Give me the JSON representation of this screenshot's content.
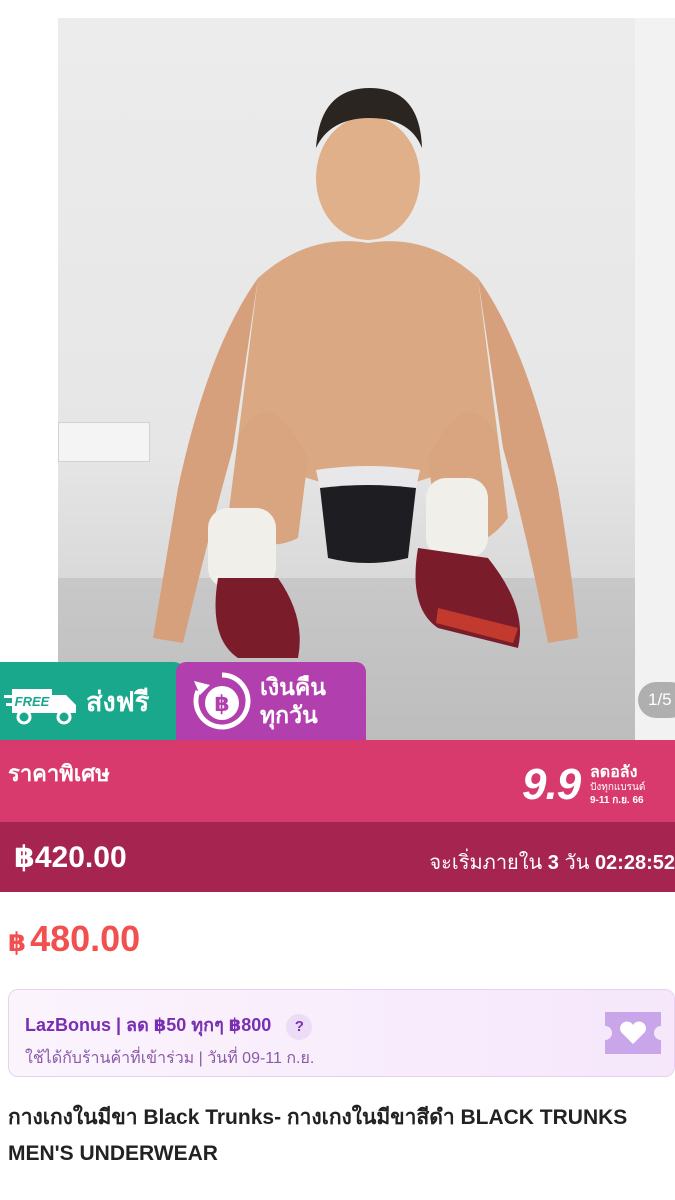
{
  "gallery": {
    "page_indicator": "1/5"
  },
  "badges": {
    "free_tag": "FREE",
    "free_shipping": "ส่งฟรี",
    "cashback_line1": "เงินคืน",
    "cashback_line2": "ทุกวัน"
  },
  "special_price": {
    "label": "ราคาพิเศษ",
    "campaign_number": "9.9",
    "campaign_main": "ลดอลัง",
    "campaign_sub": "ปังทุกแบรนด์",
    "campaign_date": "9-11 ก.ย. 66",
    "price": "฿420.00",
    "countdown_prefix": "จะเริ่มภายใน",
    "countdown_days": "3",
    "countdown_unit": "วัน",
    "countdown_time": "02:28:52"
  },
  "regular_price": {
    "currency": "฿",
    "amount": "480.00"
  },
  "lazbonus": {
    "line1": "LazBonus | ลด ฿50 ทุกๆ ฿800",
    "help": "?",
    "line2": "ใช้ได้กับร้านค้าที่เข้าร่วม | วันที่ 09-11 ก.ย."
  },
  "product": {
    "title": "กางเกงในมีขา Black Trunks- กางเกงในมีขาสีดำ BLACK TRUNKS MEN'S UNDERWEAR"
  },
  "colors": {
    "free_green": "#1aa88c",
    "cashback_purple": "#b23fae",
    "special_pink": "#d93a6e",
    "price_band": "#a52450",
    "price_red": "#f25050",
    "bonus_purple": "#7a2fb3"
  }
}
